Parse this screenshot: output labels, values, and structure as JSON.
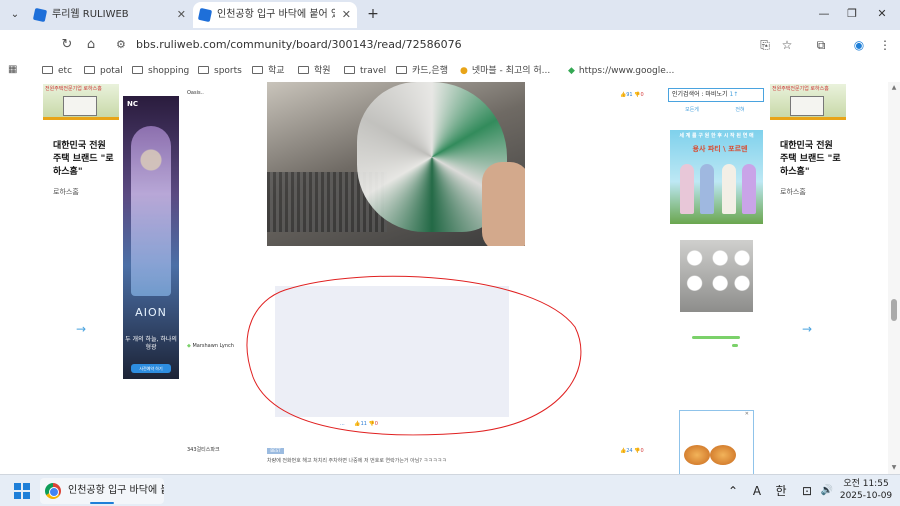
{
  "tabs": [
    {
      "label": "루리웹 RULIWEB",
      "close": "✕"
    },
    {
      "label": "인천공항 입구 바닥에 붙어 있",
      "close": "✕"
    }
  ],
  "window": {
    "minimize": "—",
    "restore": "❐",
    "close": "✕",
    "tab_search": "⌄",
    "new_tab": "+"
  },
  "toolbar": {
    "back": "←",
    "reload": "↻",
    "home": "⌂",
    "url": "bbs.ruliweb.com/community/board/300143/read/72586076",
    "site_info": "⚙",
    "cast": "⎘",
    "star": "☆",
    "extensions": "⧉",
    "profile": "◉",
    "menu": "⋮"
  },
  "bookmarks": [
    "etc",
    "potal",
    "shopping",
    "sports",
    "학교",
    "학원",
    "travel",
    "카드,은행",
    "넷마블 - 최고의 허...",
    "https://www.google..."
  ],
  "ads": {
    "house_caption": "전원주택전문기업 로하스홈",
    "house_phone": "1661-0255",
    "title": "대한민국 전원 주택 브랜드 \"로하스홈\"",
    "sub": "로하스홈"
  },
  "banner": {
    "brand": "NC",
    "game": "AION",
    "tagline": "두 개의 하늘, 하나의 형광",
    "button": "사전예약 하기"
  },
  "posts": [
    {
      "author": "Oasis..",
      "up": "91",
      "down": "0"
    },
    {
      "author": "Marshawn Lynch",
      "up": "11",
      "down": "0",
      "dots": "..."
    },
    {
      "author": "343걸티스파크",
      "up": "24",
      "down": "0",
      "badge": "BEST",
      "reply": "차량에 전화번호 해고 처치리 주차하면 나중에 저 번호로 연락가는거 아님? ㅋㅋㅋㅋㅋ"
    }
  ],
  "right_panel": {
    "title": "인기검색어 : 마비노기",
    "rank": "1↑",
    "tabs": [
      "모든게",
      "전혀"
    ]
  },
  "anime": {
    "header": "세 계 를 구 원 한  후 시 작 된 연 애",
    "logo": "용사 파티 \\ 포르덴"
  },
  "taskbar": {
    "app_label": "인천공항 입구 바닥에 붙",
    "time": "오전 11:55",
    "date": "2025-10-09",
    "tray": [
      "⌃",
      "A",
      "한",
      "🔊"
    ]
  }
}
